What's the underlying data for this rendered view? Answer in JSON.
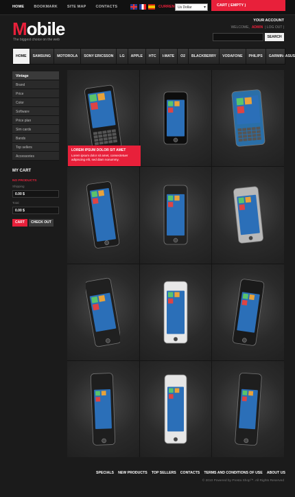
{
  "topbar": {
    "links": [
      "HOME",
      "BOOKMARK",
      "SITE MAP",
      "CONTACTS"
    ],
    "currency_label": "CURRENCIES:",
    "currency_value": "Us Dollar",
    "cart": "CART ( EMPTY )"
  },
  "header": {
    "logo_first": "M",
    "logo_rest": "obile",
    "tagline": "The biggest choice on the web",
    "account_title": "YOUR ACCOUNT",
    "welcome": "WELCOME,",
    "user": "ADMIN",
    "logout": "| LOG OUT |",
    "search_button": "SEARCH",
    "search_placeholder": ""
  },
  "nav": [
    "HOME",
    "SAMSUNG",
    "MOTOROLA",
    "SONY ERICSSON",
    "LG",
    "APPLE",
    "HTC",
    "I-MATE",
    "O2",
    "BLACKBERRY",
    "VODAFONE",
    "PHILIPS",
    "GARMIN- ASUS"
  ],
  "sidebar": {
    "header": "Vintage",
    "categories": [
      "Brand",
      "Price",
      "Color",
      "Software",
      "Price plan",
      "Sim cards",
      "Bands",
      "Top sellers",
      "Accessories"
    ]
  },
  "cart": {
    "title": "MY CART",
    "status": "NO PRODUCTS",
    "shipping_label": "Shipping",
    "shipping_value": "0.00 $",
    "total_label": "Total",
    "total_value": "0.00 $",
    "cart_button": "CART",
    "checkout_button": "CHECK OUT"
  },
  "promo": {
    "title": "LOREM IPSUM DOLOR SIT AMET",
    "text": "Lorem ipsum dolor sit amet, consectetuer adipiscing elit, sed diam nonummy."
  },
  "products": [
    {
      "icon": "slider-phone-icon",
      "color": "#1a1a1a"
    },
    {
      "icon": "iphone-icon",
      "color": "#0d0d0d"
    },
    {
      "icon": "qwerty-phone-icon",
      "color": "#2a6fa8"
    },
    {
      "icon": "xperia-phone-icon",
      "color": "#1c1c1c"
    },
    {
      "icon": "lg-phone-icon",
      "color": "#222"
    },
    {
      "icon": "nokia-n8-icon",
      "color": "#b8b8b8"
    },
    {
      "icon": "htc-phone-icon",
      "color": "#202020"
    },
    {
      "icon": "white-android-icon",
      "color": "#e8e8e8"
    },
    {
      "icon": "sony-phone-icon",
      "color": "#1a1a1a"
    },
    {
      "icon": "nokia-x6-blue-icon",
      "color": "#1e1e1e"
    },
    {
      "icon": "nokia-5800-white-icon",
      "color": "#e6e6e6"
    },
    {
      "icon": "nokia-x6-red-icon",
      "color": "#1e1e1e"
    }
  ],
  "footer": {
    "links": [
      "SPECIALS",
      "NEW PRODUCTS",
      "TOP SELLERS",
      "CONTACTS",
      "TERMS AND CONDITIONS OF USE",
      "ABOUT US"
    ],
    "copyright": "© 2010 Powered by Presta Shop™. All Rights Reserved"
  },
  "colors": {
    "accent": "#e8203a",
    "background": "#1b1b1b"
  }
}
